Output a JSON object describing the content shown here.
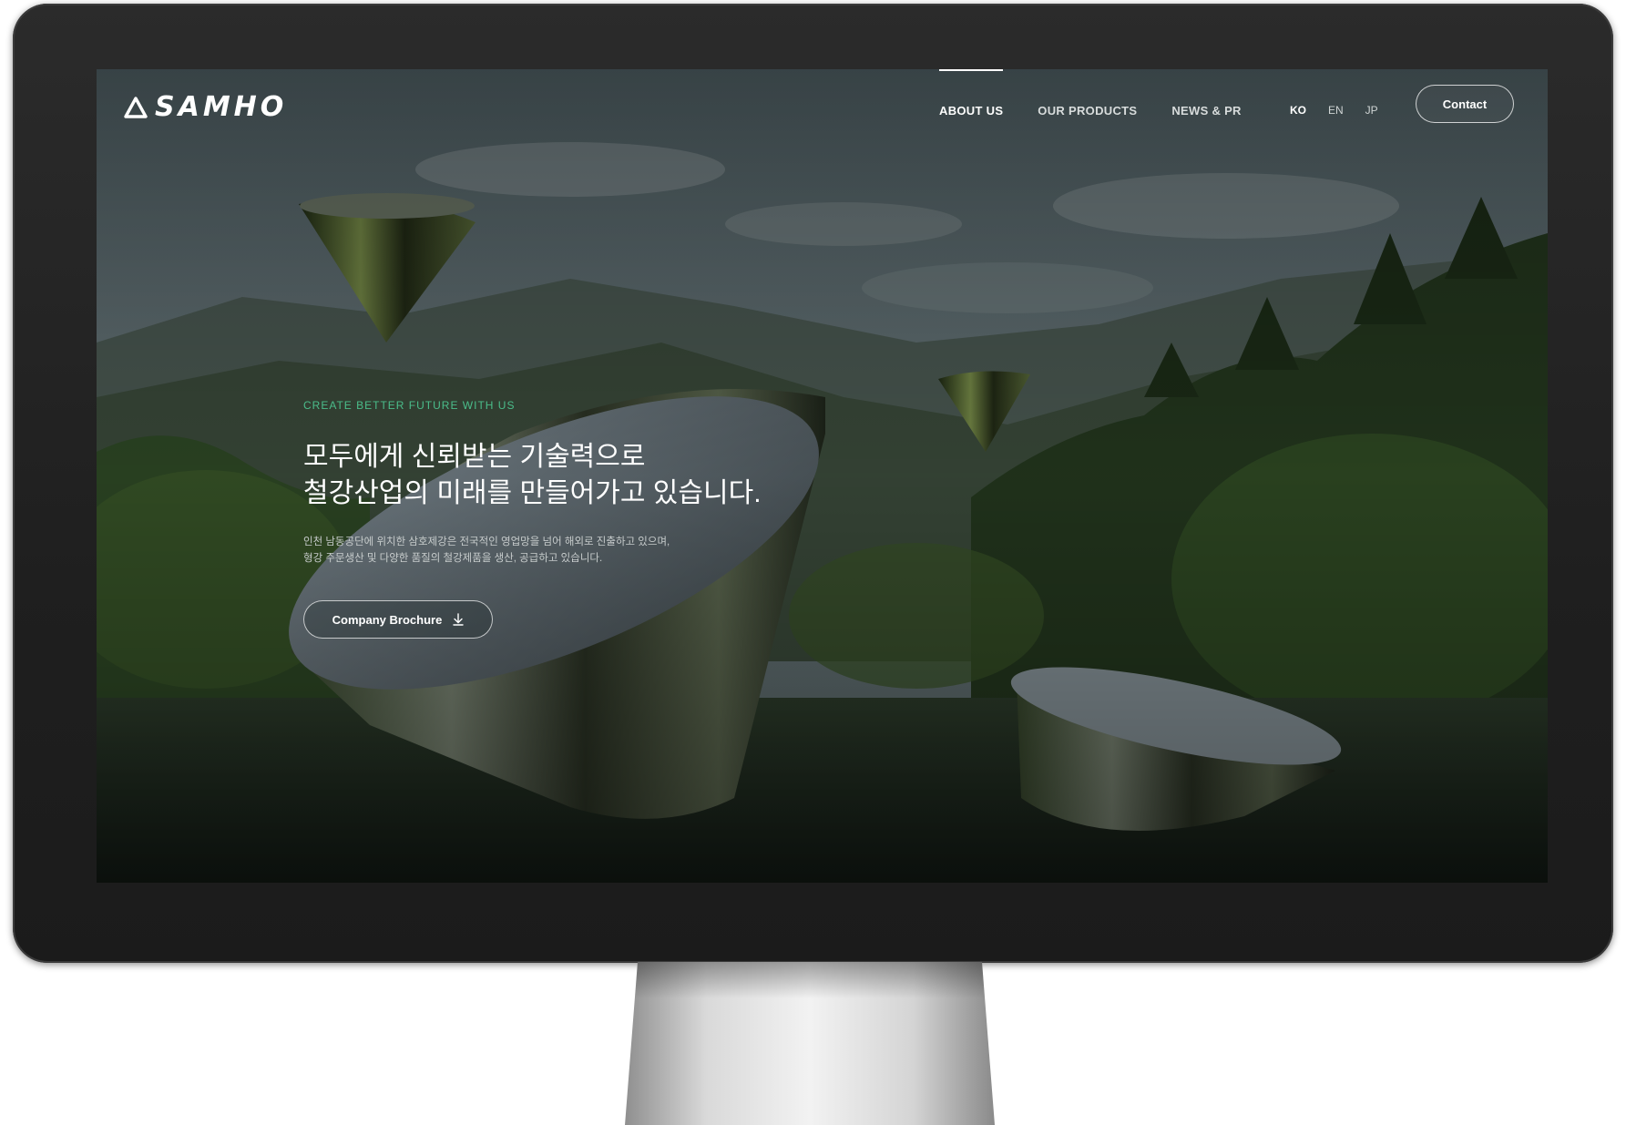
{
  "brand": {
    "name": "SAMHO"
  },
  "nav": {
    "items": [
      {
        "label": "ABOUT US",
        "active": true
      },
      {
        "label": "OUR PRODUCTS",
        "active": false
      },
      {
        "label": "NEWS & PR",
        "active": false
      }
    ],
    "languages": [
      {
        "label": "KO",
        "active": true
      },
      {
        "label": "EN",
        "active": false
      },
      {
        "label": "JP",
        "active": false
      }
    ],
    "contact_label": "Contact"
  },
  "hero": {
    "eyebrow": "CREATE BETTER FUTURE WITH US",
    "title_line1": "모두에게 신뢰받는 기술력으로",
    "title_line2": "철강산업의 미래를 만들어가고 있습니다.",
    "desc_line1": "인천 남동공단에 위치한 삼호제강은 전국적인 영업망을 넘어 해외로 진출하고 있으며,",
    "desc_line2": "형강 주문생산 및 다양한 품질의 철강제품을 생산, 공급하고 있습니다.",
    "brochure_label": "Company Brochure",
    "brochure_icon": "download-icon"
  },
  "colors": {
    "accent": "#4fd39a",
    "bezel": "#1f1f1f"
  }
}
